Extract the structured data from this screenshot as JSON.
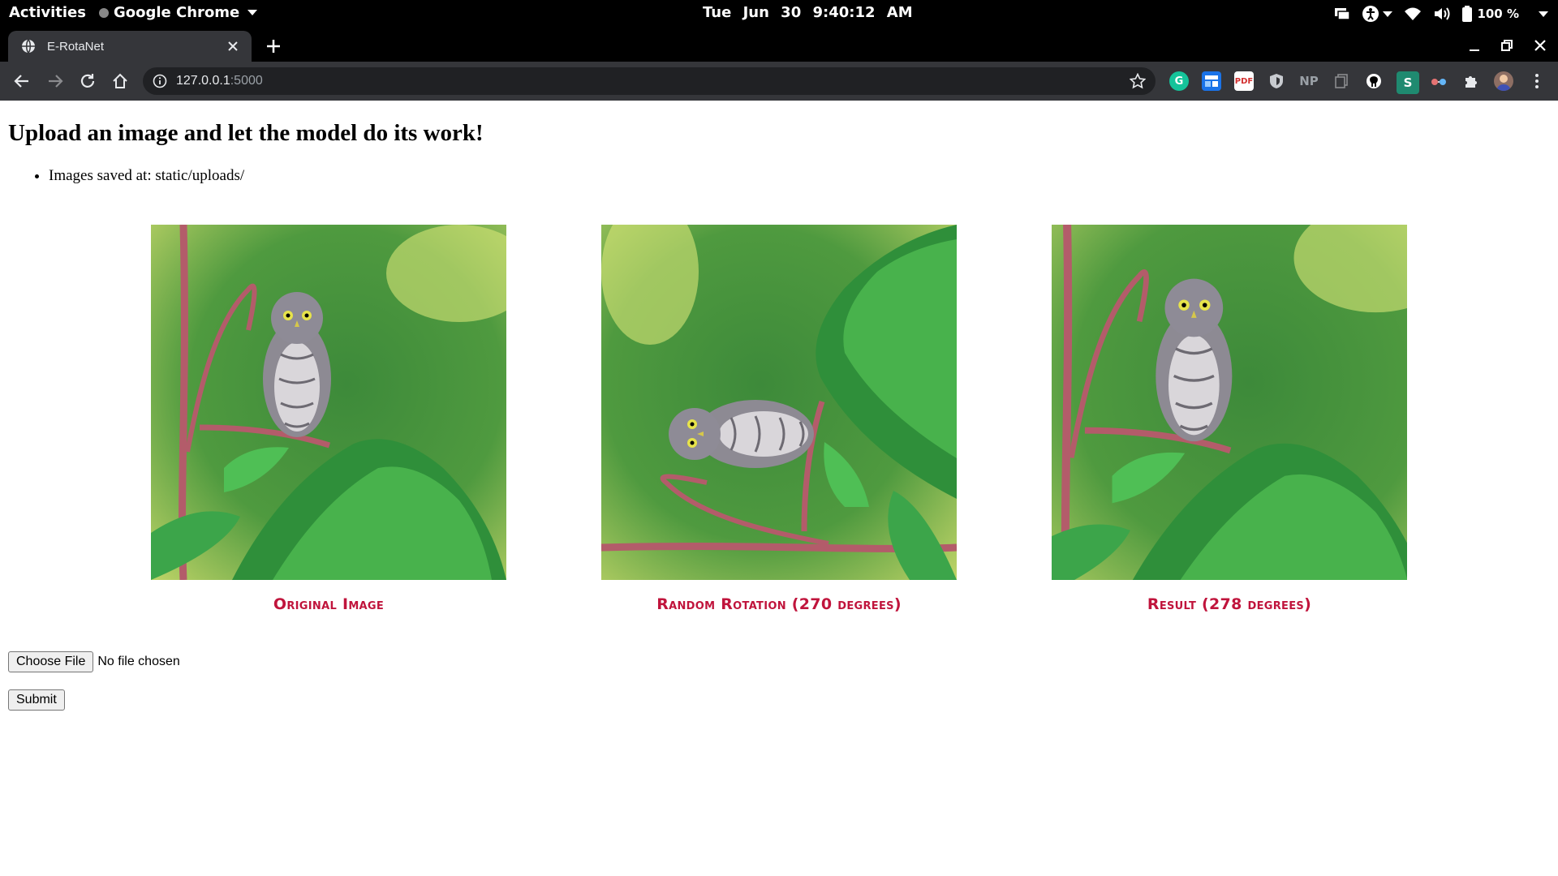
{
  "system_bar": {
    "activities": "Activities",
    "app_name": "Google Chrome",
    "clock": "Tue Jun 30   9:40:12 AM",
    "battery": "100 %"
  },
  "browser": {
    "tab_title": "E-RotaNet",
    "url_host": "127.0.0.1",
    "url_port": ":5000",
    "extensions": [
      "grammarly-icon",
      "tab-manager-icon",
      "pdf-icon",
      "shield-icon",
      "NP",
      "copy-icon",
      "github-icon",
      "S",
      "glasses-icon",
      "puzzle-icon",
      "profile-avatar"
    ]
  },
  "page": {
    "heading": "Upload an image and let the model do its work!",
    "notes": [
      "Images saved at: static/uploads/"
    ],
    "figures": [
      {
        "caption": "Original Image",
        "rotation_deg": 0
      },
      {
        "caption": "Random Rotation (270 degrees)",
        "rotation_deg": 270
      },
      {
        "caption": "Result (278 degrees)",
        "rotation_deg": 0
      }
    ],
    "file_button": "Choose File",
    "file_status": "No file chosen",
    "submit_label": "Submit"
  },
  "colors": {
    "caption": "#c0143c",
    "chrome_dark": "#35363a",
    "omnibox": "#202124"
  }
}
